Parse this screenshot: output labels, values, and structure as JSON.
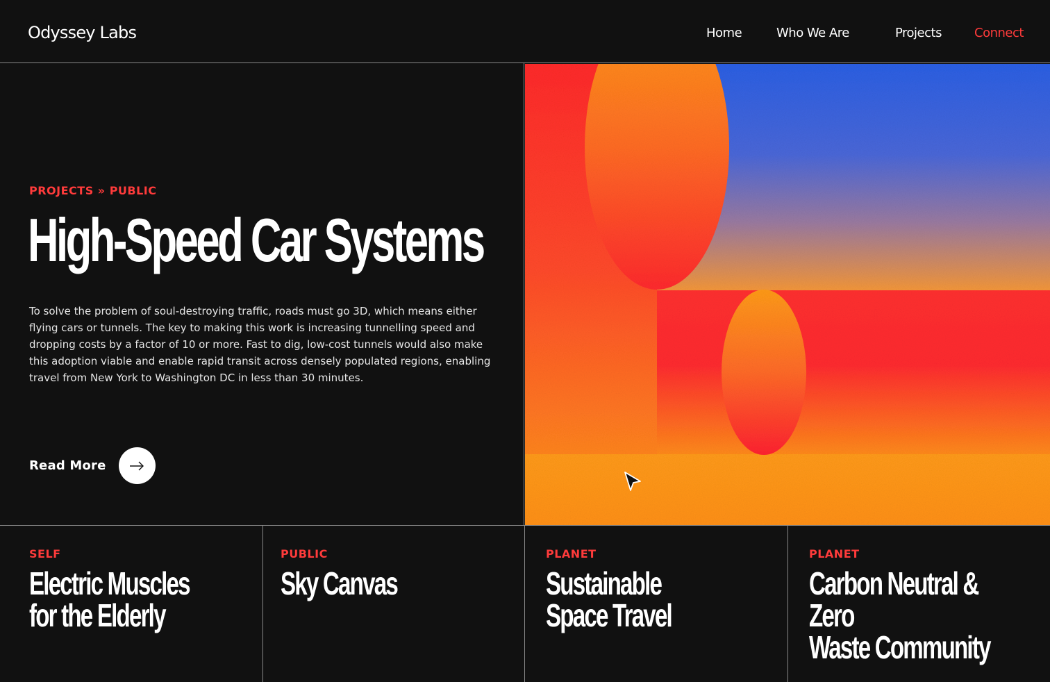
{
  "header": {
    "logo": "Odyssey Labs",
    "nav": {
      "home": "Home",
      "who_we_are": "Who We Are",
      "projects": "Projects",
      "connect": "Connect"
    }
  },
  "hero": {
    "breadcrumb": "PROJECTS » PUBLIC",
    "title": "High-Speed Car Systems",
    "description": "To solve the problem of soul-destroying traffic, roads must go 3D, which means either flying cars or tunnels. The key to making this work is increasing tunnelling speed and dropping costs by a factor of 10 or more. Fast to dig, low-cost tunnels would also make this adoption viable and enable rapid transit across densely populated regions, enabling travel from New York to Washington DC in less than 30 minutes.",
    "read_more": "Read More"
  },
  "cards": [
    {
      "tag": "SELF",
      "title_line1": "Electric Muscles",
      "title_line2": "for the Elderly"
    },
    {
      "tag": "PUBLIC",
      "title_line1": "Sky Canvas",
      "title_line2": ""
    },
    {
      "tag": "PLANET",
      "title_line1": "Sustainable",
      "title_line2": "Space Travel"
    },
    {
      "tag": "PLANET",
      "title_line1": "Carbon Neutral & Zero",
      "title_line2": "Waste Community"
    }
  ],
  "colors": {
    "accent": "#ff3b3b",
    "background": "#111111",
    "art_red": "#ff2a2a",
    "art_orange": "#ff9a1a",
    "art_blue": "#2e63e0"
  },
  "icons": {
    "read_more": "arrow-right-icon",
    "pointer": "cursor-icon"
  }
}
